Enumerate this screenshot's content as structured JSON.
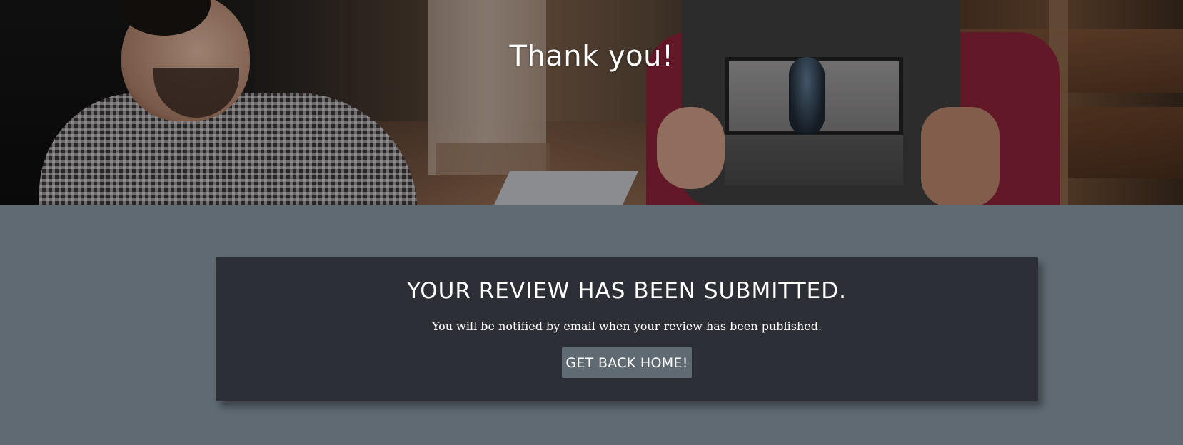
{
  "hero": {
    "title": "Thank you!"
  },
  "confirmation": {
    "heading": "YOUR REVIEW HAS BEEN SUBMITTED.",
    "message": "You will be notified by email when your review has been published.",
    "button_label": "GET BACK HOME!"
  },
  "colors": {
    "page_background": "#5f6a72",
    "card_background": "#2c2f36",
    "button_background": "#5f6a72",
    "text": "#ffffff"
  }
}
